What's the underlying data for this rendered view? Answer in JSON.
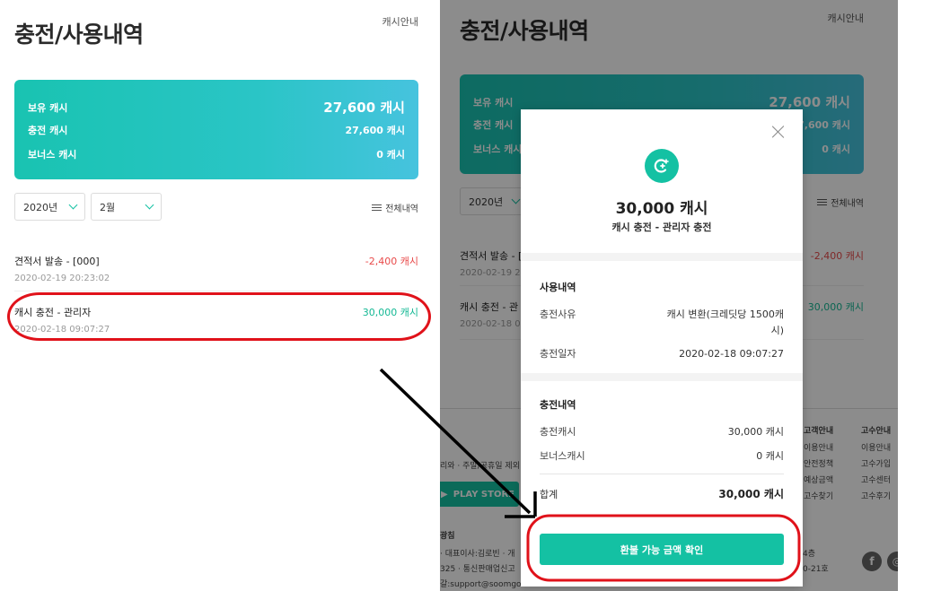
{
  "page": {
    "title": "충전/사용내역",
    "guide_link": "캐시안내"
  },
  "cash_card": {
    "held_label": "보유 캐시",
    "held_value": "27,600 캐시",
    "charged_label": "충전 캐시",
    "charged_value": "27,600 캐시",
    "bonus_label": "보너스 캐시",
    "bonus_value": "0 캐시"
  },
  "filters": {
    "year": "2020년",
    "month": "2월",
    "all_history": "전체내역"
  },
  "history": [
    {
      "title": "견적서 발송 - [000]",
      "date": "2020-02-19 20:23:02",
      "amount": "-2,400 캐시"
    },
    {
      "title": "캐시 충전 - 관리자",
      "date": "2020-02-18 09:07:27",
      "amount": "30,000 캐시"
    }
  ],
  "background": {
    "year": "2020년",
    "history_partial": [
      {
        "title": "견적서 발송 - [",
        "date": "2020-02-19 2"
      },
      {
        "title": "캐시 충전 - 관",
        "date": "2020-02-18 0"
      }
    ],
    "footer": {
      "hours": "리와 · 주말/공휴일 제외",
      "store": "PLAY STORE",
      "company": "광침",
      "ceo": "· 대표이사:김로빈 · 개",
      "reg": "325 · 통신판매업신고",
      "email": "갈:support@soomgo",
      "address_a": "4층",
      "address_b": "0-21호",
      "col1_title": "고객안내",
      "col1_items": [
        "이용안내",
        "안전정책",
        "예상금액",
        "고수찾기"
      ],
      "col2_title": "고수안내",
      "col2_items": [
        "이용안내",
        "고수가입",
        "고수센터",
        "고수후기"
      ]
    }
  },
  "modal": {
    "amount": "30,000 캐시",
    "subtitle": "캐시 충전 - 관리자 충전",
    "usage_section": "사용내역",
    "reason_label": "충전사유",
    "reason_value_1": "캐시 변환(크레딧당 1500캐",
    "reason_value_2": "시)",
    "date_label": "충전일자",
    "date_value": "2020-02-18 09:07:27",
    "charge_section": "충전내역",
    "charged_label": "충전캐시",
    "charged_value": "30,000 캐시",
    "bonus_label": "보너스캐시",
    "bonus_value": "0 캐시",
    "total_label": "합계",
    "total_value": "30,000 캐시",
    "refund_button": "환불 가능 금액 확인"
  },
  "colors": {
    "accent": "#14c1a3",
    "negative": "#e84a4a",
    "annotation": "#e0121a"
  }
}
